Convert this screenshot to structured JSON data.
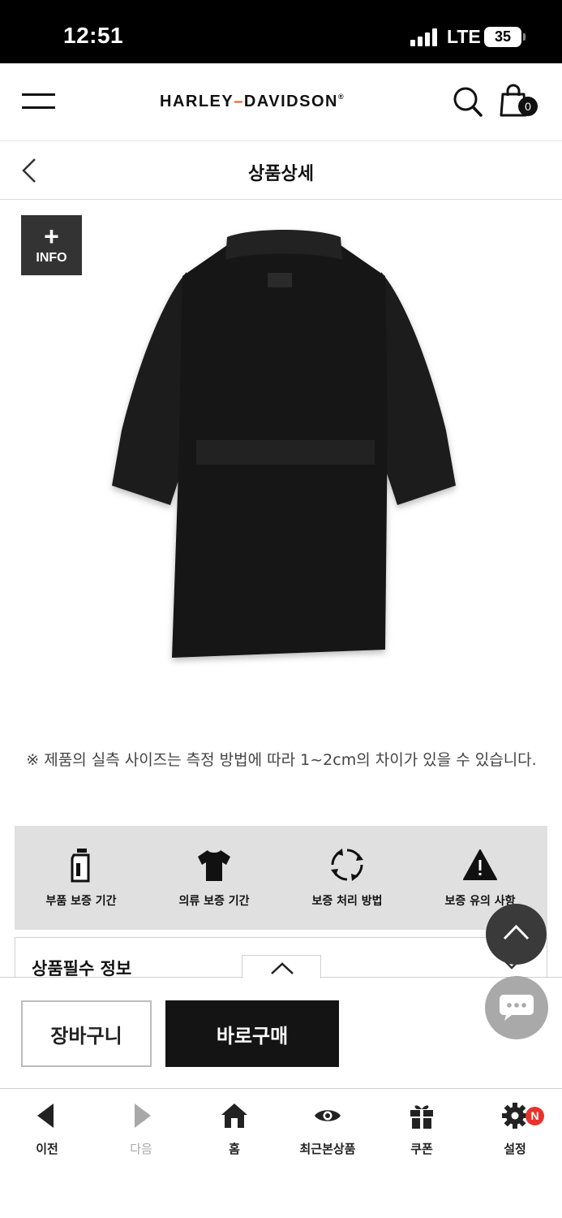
{
  "status_bar": {
    "time": "12:51",
    "network": "LTE",
    "battery": "35"
  },
  "header": {
    "brand_left": "HARLEY",
    "brand_dash": "–",
    "brand_right": "DAVIDSON",
    "brand_mark": "®",
    "cart_count": "0"
  },
  "sub_header": {
    "title": "상품상세"
  },
  "product": {
    "info_badge_plus": "+",
    "info_badge_label": "INFO"
  },
  "notice": "※ 제품의 실측 사이즈는 측정 방법에 따라 1~2cm의 차이가 있을 수 있습니다.",
  "info_panel": {
    "items": [
      {
        "label": "부품 보증 기간",
        "icon": "bottle-icon"
      },
      {
        "label": "의류 보증 기간",
        "icon": "tshirt-icon"
      },
      {
        "label": "보증 처리 방법",
        "icon": "cycle-arrows-icon"
      },
      {
        "label": "보증 유의 사항",
        "icon": "warning-icon"
      }
    ]
  },
  "spec": {
    "title": "상품필수 정보"
  },
  "purchase": {
    "cart_label": "장바구니",
    "buy_label": "바로구매"
  },
  "bottom_nav": {
    "items": [
      {
        "label": "이전",
        "icon": "back-arrow-icon"
      },
      {
        "label": "다음",
        "icon": "forward-arrow-icon"
      },
      {
        "label": "홈",
        "icon": "home-icon"
      },
      {
        "label": "최근본상품",
        "icon": "eye-icon"
      },
      {
        "label": "쿠폰",
        "icon": "gift-icon"
      },
      {
        "label": "설정",
        "icon": "gear-icon"
      }
    ],
    "settings_badge": "N"
  },
  "colors": {
    "accent": "#e85a1e",
    "buy_button": "#141414",
    "badge": "#e8322b"
  }
}
